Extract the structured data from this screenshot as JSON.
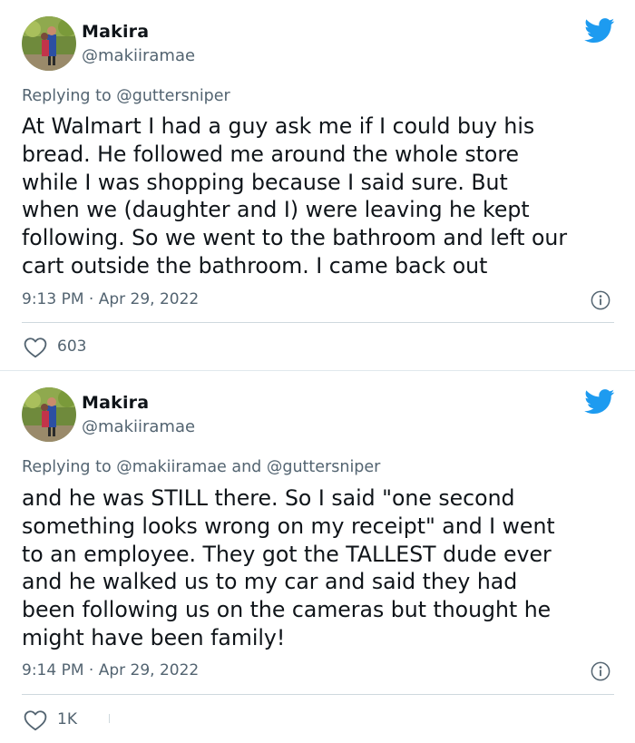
{
  "colors": {
    "accent": "#1d9bf0",
    "text": "#0f1419",
    "secondary": "#536471",
    "divider": "#cfd9de"
  },
  "tweets": [
    {
      "name": "Makira",
      "handle": "@makiiramae",
      "reply": "Replying to @guttersniper",
      "text": "At Walmart I had a guy ask me if I could buy his\nbread. He followed me around the whole store\nwhile I was shopping because I said sure. But\nwhen we (daughter and I) were leaving he kept\nfollowing. So we went to the bathroom and left our\ncart outside the bathroom. I came back out",
      "time": "9:13 PM",
      "date": "Apr 29, 2022",
      "likes": "603",
      "icons": [
        "avatar",
        "twitter-bird-icon",
        "info-icon",
        "heart-icon"
      ]
    },
    {
      "name": "Makira",
      "handle": "@makiiramae",
      "reply": "Replying to @makiiramae and @guttersniper",
      "text": "and he was STILL there. So I said \"one second\nsomething looks wrong on my receipt\" and I went\nto an employee. They got the TALLEST dude ever\nand he walked us to my car and said they had\nbeen following us on the cameras but thought he\nmight have been family!",
      "time": "9:14 PM",
      "date": "Apr 29, 2022",
      "likes": "1K",
      "icons": [
        "avatar",
        "twitter-bird-icon",
        "info-icon",
        "heart-icon"
      ]
    }
  ]
}
